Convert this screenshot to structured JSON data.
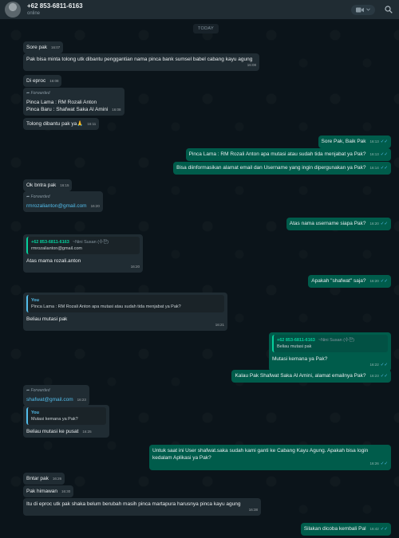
{
  "header": {
    "contact_name": "+62 853-6811-6163",
    "status": "online",
    "video_icon": "video-call-icon",
    "chevron_icon": "chevron-down-icon",
    "search_icon": "search-icon"
  },
  "chat": {
    "date_label": "TODAY",
    "forwarded_label": "Forwarded",
    "messages": [
      {
        "text": "Sore pak",
        "time": "16:07"
      },
      {
        "text": "Pak bisa minta tolong utk dibantu penggantian nama pinca bank sumsel babel cabang kayu agung",
        "time": "16:08"
      },
      {
        "text": "Di eproc",
        "time": "16:08"
      },
      {
        "line1": "Pinca Lama : RM Rozali Anton",
        "line2": "Pinca Baru : Shafwat Saka Al Amini",
        "time": "16:08"
      },
      {
        "text": "Tolong dibantu pak ya🙏",
        "time": "16:11"
      },
      {
        "text": "Sore Pak, Baik Pak",
        "time": "16:13"
      },
      {
        "text": "Pinca Lama : RM Rozali Anton apa mutasi atau sudah tida menjabat ya Pak?",
        "time": "16:13"
      },
      {
        "text": "Bisa diinformasikan alamat email dan Username yang ingin dipergunakan ya Pak?",
        "time": "16:14"
      },
      {
        "text": "Ok bntra pak",
        "time": "16:15"
      },
      {
        "text": "rmrozalianton@gmail.com",
        "time": "16:20"
      },
      {
        "text": "Atas nama username siapa Pak?",
        "time": "16:20"
      },
      {
        "quote_author": "+62 853-6811-6163",
        "quote_push": "~Nini Susan (수잔)",
        "quote_text": "rmrozalianton@gmail.com",
        "text": "Atas mama rozali.anton",
        "time": "16:20"
      },
      {
        "text": "Apakah \"shafwat\" saja?",
        "time": "16:20"
      },
      {
        "quote_author": "You",
        "quote_text": "Pinca Lama : RM Rozali Anton apa mutasi atau sudah tida menjabat ya Pak?",
        "text": "Beliau mutasi pak",
        "time": "16:21"
      },
      {
        "quote_author": "+62 853-6811-6163",
        "quote_push": "~Nini Susan (수잔)",
        "quote_text": "Beliau mutasi pak",
        "text": "Mutasi kemana ya Pak?",
        "time": "16:22"
      },
      {
        "text": "Kalau Pak Shafwat Saka Al Amini, alamat emailnya Pak?",
        "time": "16:23"
      },
      {
        "text": "shafwat@gmail.com",
        "time": "16:23"
      },
      {
        "quote_author": "You",
        "quote_text": "Mutasi kemana ya Pak?",
        "text": "Beliau mutasi ke pusat",
        "time": "16:25"
      },
      {
        "line1": "Untuk saat ini User shafwat.saka sudah kami ganti ke Cabang Kayu Agung. Apakah bisa login",
        "line2": "kedalam Aplikasi ya Pak?",
        "time": "16:26"
      },
      {
        "text": "Bntar pak",
        "time": "16:26"
      },
      {
        "text": "Pak himawan",
        "time": "16:30"
      },
      {
        "text": "Itu di eproc utk pak shaka belum berubah masih pinca martapura harusnya pinca kayu agung",
        "time": "16:38"
      },
      {
        "text": "Silakan dicoba kembali Pal",
        "time": "16:42"
      }
    ]
  },
  "colors": {
    "incoming_bubble": "#202c33",
    "outgoing_bubble": "#005c4b",
    "background": "#0b141a",
    "accent": "#06cf9c",
    "read_tick": "#53bdeb"
  }
}
